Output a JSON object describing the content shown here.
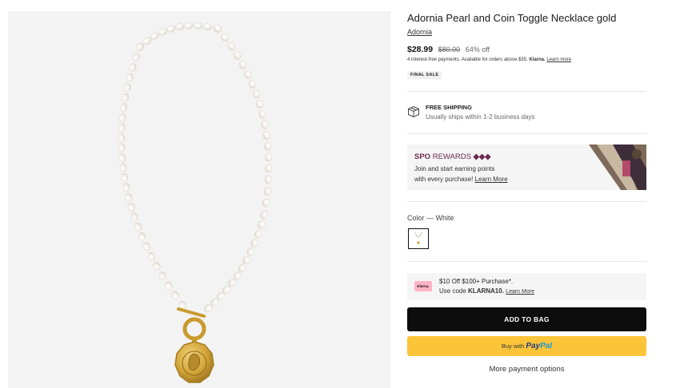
{
  "product": {
    "title": "Adornia Pearl and Coin Toggle Necklace gold",
    "brand": "Adornia",
    "price_current": "$28.99",
    "price_original": "$80.00",
    "discount": "64% off",
    "klarna_text": "4 interest-free payments. Available for orders above $35.",
    "klarna_brand": "Klarna.",
    "klarna_link": "Learn more",
    "badge": "FINAL SALE"
  },
  "shipping": {
    "title": "FREE SHIPPING",
    "subtitle": "Usually ships within 1-2 business days",
    "icon": "box-icon"
  },
  "rewards": {
    "title_bold": "SPO",
    "title_light": "REWARDS",
    "diamonds": "◆◆◆",
    "line1": "Join and start earning points",
    "line2": "with every purchase!",
    "link": "Learn More",
    "accent": "#6b2a4f"
  },
  "color": {
    "label": "Color — White",
    "selected": "White"
  },
  "promo": {
    "badge": "Klarna.",
    "title": "$10 Off $100+ Purchase*.",
    "code_prefix": "Use code",
    "code": "KLARNA10.",
    "link": "Learn More"
  },
  "actions": {
    "add_to_bag": "ADD TO BAG",
    "paypal_prefix": "Buy with",
    "paypal_brand_1": "Pay",
    "paypal_brand_2": "Pal",
    "more_payment": "More payment options",
    "paypal_color": "#fcc439"
  }
}
